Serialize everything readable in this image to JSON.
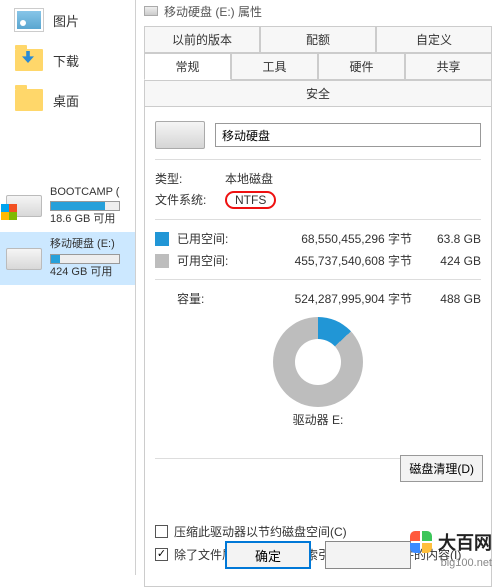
{
  "nav": {
    "pictures": "图片",
    "downloads": "下载",
    "desktop": "桌面"
  },
  "drives": [
    {
      "name": "BOOTCAMP (",
      "free": "18.6 GB 可用",
      "fill": 80,
      "win": true
    },
    {
      "name": "移动硬盘 (E:)",
      "free": "424 GB 可用",
      "fill": 13,
      "win": false
    }
  ],
  "dialog": {
    "title": "移动硬盘 (E:) 属性",
    "tabs_row1": [
      "以前的版本",
      "配额",
      "自定义"
    ],
    "tabs_row2": [
      "常规",
      "工具",
      "硬件",
      "共享",
      "安全"
    ],
    "active_tab": "常规",
    "drive_name": "移动硬盘",
    "type_label": "类型:",
    "type_value": "本地磁盘",
    "fs_label": "文件系统:",
    "fs_value": "NTFS",
    "used_label": "已用空间:",
    "used_bytes": "68,550,455,296 字节",
    "used_gb": "63.8 GB",
    "free_label": "可用空间:",
    "free_bytes": "455,737,540,608 字节",
    "free_gb": "424 GB",
    "cap_label": "容量:",
    "cap_bytes": "524,287,995,904 字节",
    "cap_gb": "488 GB",
    "drive_letter": "驱动器 E:",
    "cleanup": "磁盘清理(D)",
    "chk_compress": "压缩此驱动器以节约磁盘空间(C)",
    "chk_index": "除了文件属性外，还允许索引此驱动器上文件的内容(I)",
    "ok": "确定"
  },
  "watermark": {
    "text": "大百网",
    "url": "big100.net"
  }
}
